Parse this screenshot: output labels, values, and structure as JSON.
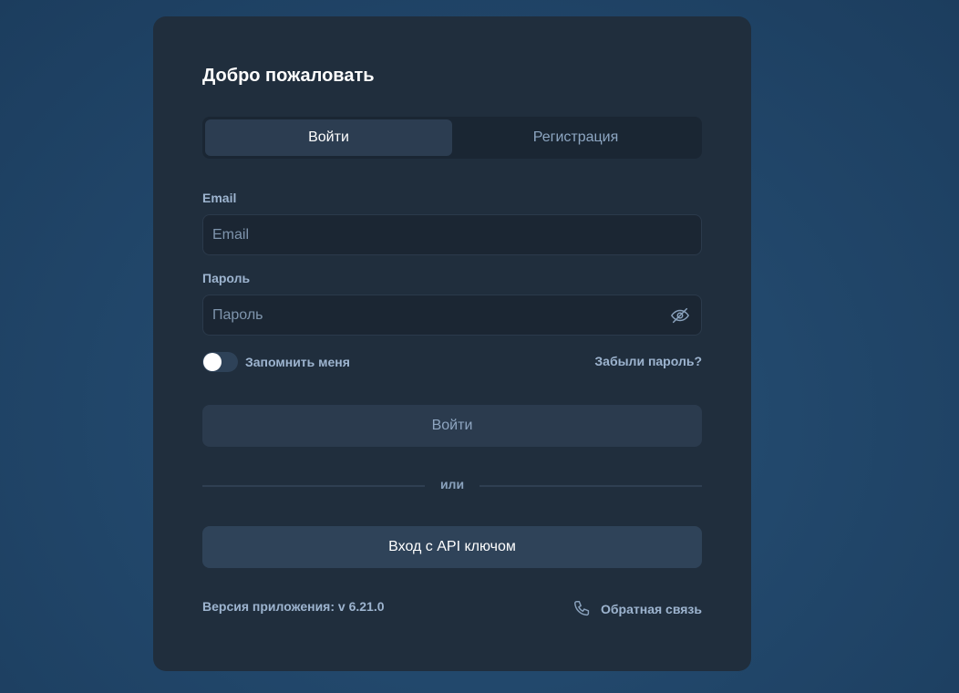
{
  "title": "Добро пожаловать",
  "tabs": [
    {
      "label": "Войти",
      "active": true
    },
    {
      "label": "Регистрация",
      "active": false
    }
  ],
  "email": {
    "label": "Email",
    "placeholder": "Email",
    "value": ""
  },
  "password": {
    "label": "Пароль",
    "placeholder": "Пароль",
    "value": "",
    "visibility_icon": "eye-off-icon"
  },
  "remember": {
    "label": "Запомнить меня",
    "checked": false
  },
  "forgot_label": "Забыли пароль?",
  "login_button": "Войти",
  "divider_label": "или",
  "api_button": "Вход с API ключом",
  "version_label": "Версия приложения: v 6.21.0",
  "feedback": {
    "label": "Обратная связь",
    "icon": "phone-icon"
  },
  "colors": {
    "background": "#22486c",
    "card": "#202e3d",
    "accent_text": "#9db4cf",
    "api_button": "#2f4359"
  }
}
